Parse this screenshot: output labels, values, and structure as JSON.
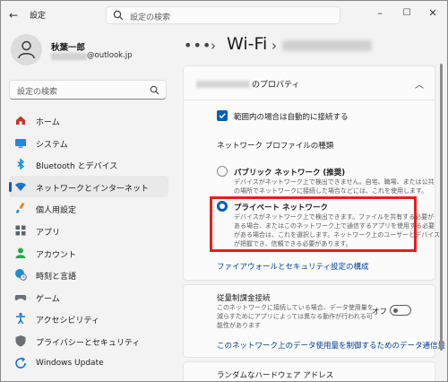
{
  "app": {
    "title": "設定"
  },
  "title_search": {
    "placeholder": "設定の検索"
  },
  "window_controls": {
    "minimize": "–",
    "maximize": "☐",
    "close": "✕"
  },
  "user": {
    "name": "秋葉一郎",
    "email_suffix": "@outlook.jp"
  },
  "sidebar_search": {
    "placeholder": "設定の検索"
  },
  "nav": [
    {
      "label": "ホーム",
      "icon": "home-icon",
      "color": "#c0392b"
    },
    {
      "label": "システム",
      "icon": "monitor-icon",
      "color": "#1a8fd6"
    },
    {
      "label": "Bluetooth とデバイス",
      "icon": "bluetooth-icon",
      "color": "#1a8fd6"
    },
    {
      "label": "ネットワークとインターネット",
      "icon": "wifi-icon",
      "color": "#1a73c9",
      "active": true
    },
    {
      "label": "個人用設定",
      "icon": "brush-icon",
      "color": "#e08a1e"
    },
    {
      "label": "アプリ",
      "icon": "apps-icon",
      "color": "#5a6470"
    },
    {
      "label": "アカウント",
      "icon": "account-icon",
      "color": "#2ea44f"
    },
    {
      "label": "時刻と言語",
      "icon": "globe-clock-icon",
      "color": "#1a8fd6"
    },
    {
      "label": "ゲーム",
      "icon": "gamepad-icon",
      "color": "#6b6f75"
    },
    {
      "label": "アクセシビリティ",
      "icon": "accessibility-icon",
      "color": "#1a73c9"
    },
    {
      "label": "プライバシーとセキュリティ",
      "icon": "shield-icon",
      "color": "#6b6f75"
    },
    {
      "label": "Windows Update",
      "icon": "update-icon",
      "color": "#1a73c9"
    }
  ],
  "breadcrumb": {
    "dots": "•••",
    "chevron": "›",
    "current": "Wi-Fi"
  },
  "properties": {
    "title_suffix": "のプロパティ",
    "auto_connect_label": "範囲内の場合は自動的に接続する",
    "auto_connect_checked": true,
    "profile_type_label": "ネットワーク プロファイルの種類",
    "public": {
      "label": "パブリック ネットワーク (推奨)",
      "desc": [
        "デバイスがネットワーク上で検出できません。自宅、職場、または公共",
        "の場所でネットワークに接続した場合などには、これを使用します。"
      ]
    },
    "private": {
      "label": "プライベート ネットワーク",
      "selected": true,
      "desc": [
        "デバイスがネットワーク上で検出できます。ファイルを共有する必要が",
        "ある場合、またはこのネットワーク上で通信するアプリを使用する必要",
        "がある場合は、これを選択します。ネットワーク上のユーザーとデバイス",
        "が把握でき、信頼できる必要があります。"
      ]
    },
    "firewall_link": "ファイアウォールとセキュリティ設定の構成"
  },
  "metered": {
    "label": "従量制課金接続",
    "desc": [
      "このネットワークに接続している場合、データ使用量を",
      "減らすためにアプリによっては異なる動作が行われる可",
      "能性があります"
    ],
    "toggle_label": "オフ",
    "toggle_on": false,
    "limit_link": "このネットワーク上のデータ使用量を制御するためのデータ通信量"
  },
  "random_hw": {
    "label": "ランダムなハードウェア アドレス"
  },
  "colors": {
    "accent": "#005fb8",
    "link": "#003e92",
    "highlight": "#e02020"
  }
}
